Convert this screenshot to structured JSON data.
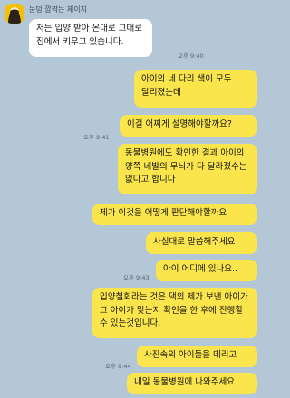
{
  "contact": {
    "name": "눈덩 깜짝는 제이지",
    "avatar_icon": "cartoon-avatar-icon"
  },
  "messages": [
    {
      "dir": "in",
      "text": "저는 입양 받아 온대로 그대로 집에서 키우고 있습니다.",
      "time": "오후 9:40"
    },
    {
      "dir": "out",
      "text": "아이의 네 다리 색이 모두 달리졌는데"
    },
    {
      "dir": "out",
      "text": "이걸 어찌게 설명해야할까요?",
      "time": "오후 9:41"
    },
    {
      "dir": "out",
      "text": "동물병원에도 확인한 결과 아이의 양쪽 네발의 무늬가 다 달라졌수는 없다고 합니다"
    },
    {
      "dir": "out",
      "text": "제가 이것을 어떻게 판단해야할까요"
    },
    {
      "dir": "out",
      "text": "사실대로 말씀해주세요"
    },
    {
      "dir": "out",
      "text": "아이 어디에 있나요..",
      "time": "오후 9:43"
    },
    {
      "dir": "out",
      "text": "입양철회라는 것은 댁의 제가 보낸 아이가 그 아이가 맞는지 확인을 한 후에 진행할 수 있는것입니다."
    },
    {
      "dir": "out",
      "text": "사진속의 아이들을 데리고",
      "time": "오후 9:44"
    },
    {
      "dir": "out",
      "text": "내일 동물병원에 나와주세요"
    }
  ],
  "colors": {
    "background": "#b3c7d7",
    "incoming_bubble": "#ffffff",
    "outgoing_bubble": "#fbe54d"
  }
}
